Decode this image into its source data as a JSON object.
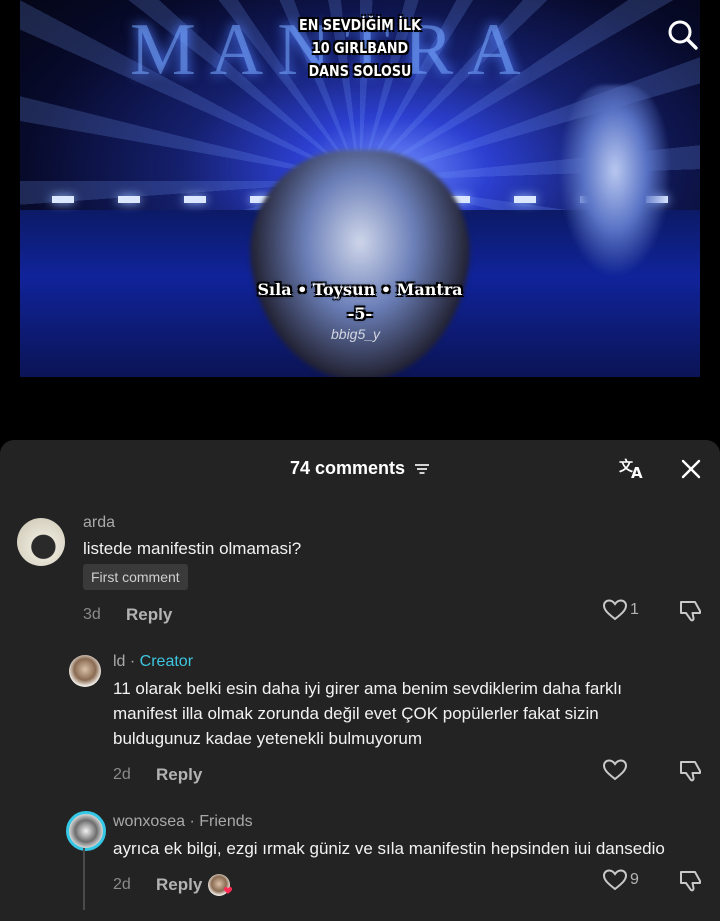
{
  "video": {
    "top_caption_lines": [
      "EN SEVDİĞİM İLK",
      "10 GIRLBAND",
      "DANS SOLOSU"
    ],
    "background_title": "MANTRA",
    "mid_caption_lines": [
      "Sıla • Toysun • Mantra",
      "-5-"
    ],
    "watermark": "bbig5_y"
  },
  "header": {
    "comment_count": "74 comments",
    "icons": {
      "filter": "filter-icon",
      "translate": "translate-icon",
      "close": "close-icon",
      "search": "search-icon"
    }
  },
  "comments": [
    {
      "username": "arda",
      "text": "listede manifestin olmamasi?",
      "badge": "First comment",
      "time": "3d",
      "reply_label": "Reply",
      "likes": "1"
    },
    {
      "username": "ld",
      "tag": "Creator",
      "separator": " · ",
      "text": "11 olarak belki esin daha iyi girer ama benim sevdiklerim daha farklı manifest illa olmak zorunda değil evet ÇOK popülerler fakat sizin buldugunuz kadae yetenekli bulmuyorum",
      "time": "2d",
      "reply_label": "Reply"
    },
    {
      "username": "wonxosea",
      "tag": "Friends",
      "separator": " · ",
      "text": "ayrıca ek bilgi, ezgi ırmak güniz ve sıla manifestin hepsinden iui dansedio",
      "time": "2d",
      "reply_label": "Reply",
      "likes": "9"
    }
  ],
  "colors": {
    "sheet_bg": "#232323",
    "tag_accent": "#3ec6e0",
    "story_ring": "#35c7e6"
  }
}
